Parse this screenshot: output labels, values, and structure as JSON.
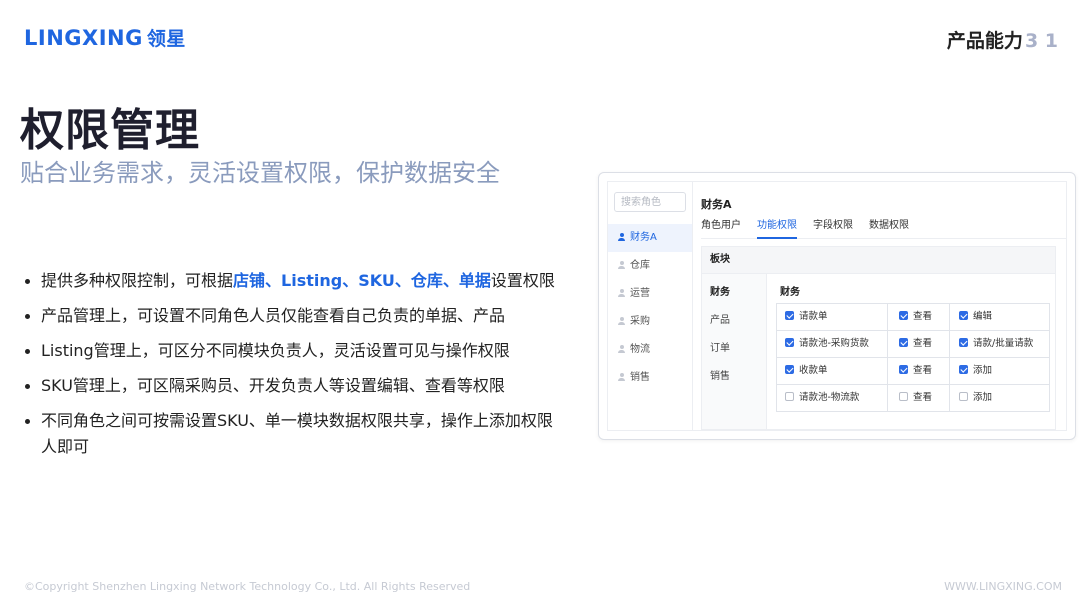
{
  "header": {
    "logo_text": "LINGXING",
    "logo_cn": "领星",
    "section_title": "产品能力",
    "page_number": "3 1"
  },
  "title": "权限管理",
  "subtitle": "贴合业务需求，灵活设置权限，保护数据安全",
  "bullets": [
    {
      "pre": "提供多种权限控制，可根据",
      "highlight": "店铺、Listing、SKU、仓库、单据",
      "post": "设置权限"
    },
    {
      "text": "产品管理上，可设置不同角色人员仅能查看自己负责的单据、产品"
    },
    {
      "text": "Listing管理上，可区分不同模块负责人，灵活设置可见与操作权限"
    },
    {
      "text": "SKU管理上，可区隔采购员、开发负责人等设置编辑、查看等权限"
    },
    {
      "text": "不同角色之间可按需设置SKU、单一模块数据权限共享，操作上添加权限人即可"
    }
  ],
  "panel": {
    "search_placeholder": "搜索角色",
    "roles": [
      "财务A",
      "仓库",
      "运营",
      "采购",
      "物流",
      "销售"
    ],
    "role_name": "财务A",
    "tabs": [
      "角色用户",
      "功能权限",
      "字段权限",
      "数据权限"
    ],
    "active_tab": "功能权限",
    "section_header": "板块",
    "modules": [
      "财务",
      "产品",
      "订单",
      "销售"
    ],
    "group_name": "财务",
    "rows": [
      {
        "name": "请款单",
        "name_checked": true,
        "view": "查看",
        "view_checked": true,
        "action": "编辑",
        "action_checked": true
      },
      {
        "name": "请款池-采购货款",
        "name_checked": true,
        "view": "查看",
        "view_checked": true,
        "action": "请款/批量请款",
        "action_checked": true
      },
      {
        "name": "收款单",
        "name_checked": true,
        "view": "查看",
        "view_checked": true,
        "action": "添加",
        "action_checked": true
      },
      {
        "name": "请款池-物流款",
        "name_checked": false,
        "view": "查看",
        "view_checked": false,
        "action": "添加",
        "action_checked": false
      }
    ]
  },
  "footer": {
    "copyright": "©Copyright Shenzhen Lingxing Network Technology Co., Ltd. All Rights Reserved",
    "website": "WWW.LINGXING.COM"
  },
  "colors": {
    "accent": "#1f66e0",
    "subtitle": "#8a9bbd",
    "checkbox": "#2d6be4"
  }
}
